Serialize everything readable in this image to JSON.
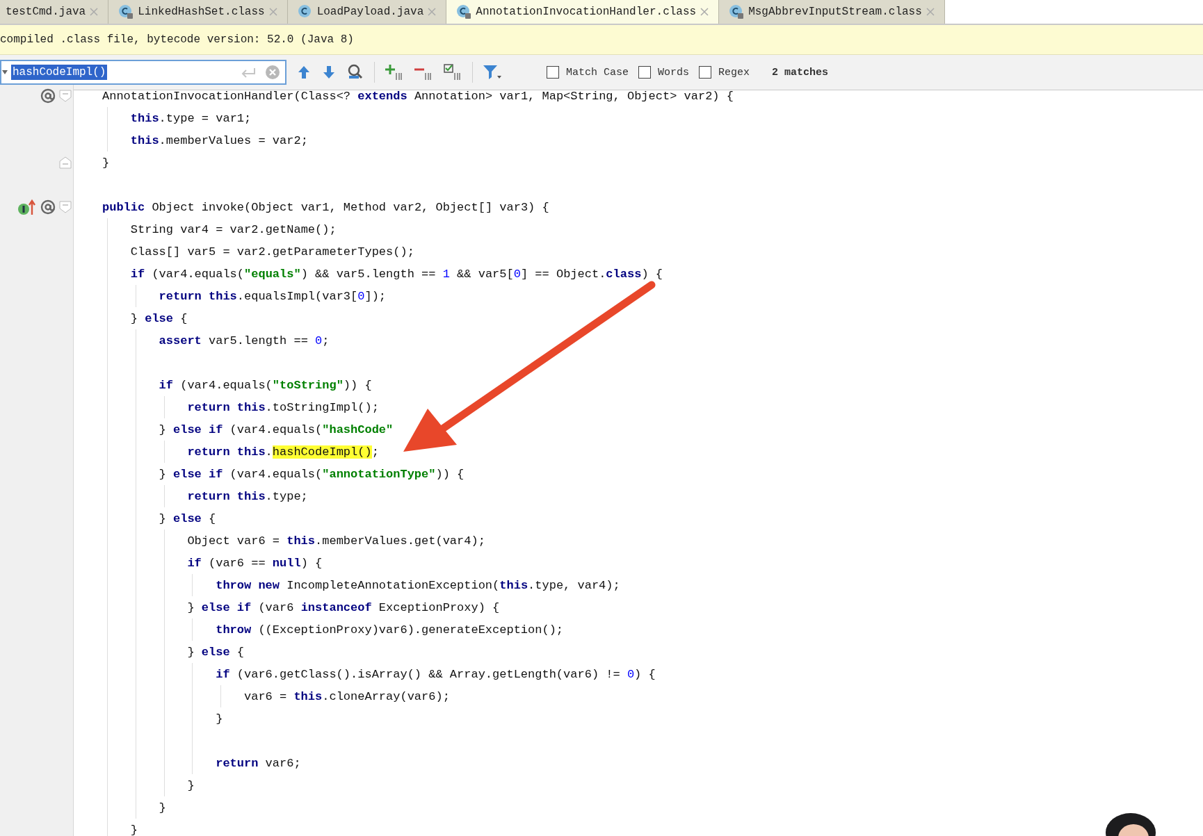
{
  "tabs": [
    {
      "label": "testCmd.java",
      "kind": "plain",
      "selected": false
    },
    {
      "label": "LinkedHashSet.class",
      "kind": "class-locked",
      "selected": false
    },
    {
      "label": "LoadPayload.java",
      "kind": "class",
      "selected": false
    },
    {
      "label": "AnnotationInvocationHandler.class",
      "kind": "class-locked",
      "selected": true
    },
    {
      "label": "MsgAbbrevInputStream.class",
      "kind": "class-locked",
      "selected": false
    }
  ],
  "info_bar": {
    "text": "compiled .class file, bytecode version: 52.0 (Java 8)"
  },
  "search_bar": {
    "value": "hashCodeImpl()",
    "value_selected": true,
    "options": [
      {
        "label": "Match Case",
        "checked": false
      },
      {
        "label": "Words",
        "checked": false
      },
      {
        "label": "Regex",
        "checked": false
      }
    ],
    "result": "2 matches"
  },
  "code": [
    {
      "kind": "code",
      "annotation_mark": true,
      "fold_open": true,
      "segments": [
        {
          "kind": "text",
          "text": "AnnotationInvocationHandler(Class<? "
        },
        {
          "kind": "kw",
          "text": "extends"
        },
        {
          "kind": "text",
          "text": " Annotation> var1, Map<String, Object> var2) {"
        }
      ],
      "children": [
        {
          "kind": "code",
          "segments": [
            {
              "kind": "kw",
              "text": "this"
            },
            {
              "kind": "text",
              "text": ".type = var1;"
            }
          ]
        },
        {
          "kind": "code",
          "segments": [
            {
              "kind": "kw",
              "text": "this"
            },
            {
              "kind": "text",
              "text": ".memberValues = var2;"
            }
          ]
        }
      ]
    },
    {
      "kind": "code",
      "fold_close": true,
      "segments": [
        {
          "kind": "text",
          "text": "}"
        }
      ]
    },
    {
      "kind": "blank"
    },
    {
      "kind": "code",
      "implements_mark": true,
      "annotation_mark": true,
      "fold_open": true,
      "segments": [
        {
          "kind": "kw",
          "text": "public"
        },
        {
          "kind": "text",
          "text": " Object invoke(Object var1, Method var2, Object[] var3) {"
        }
      ],
      "children": [
        {
          "kind": "code",
          "segments": [
            {
              "kind": "text",
              "text": "String var4 = var2.getName();"
            }
          ]
        },
        {
          "kind": "code",
          "segments": [
            {
              "kind": "text",
              "text": "Class[] var5 = var2.getParameterTypes();"
            }
          ]
        },
        {
          "kind": "code",
          "segments": [
            {
              "kind": "kw",
              "text": "if"
            },
            {
              "kind": "text",
              "text": " (var4.equals("
            },
            {
              "kind": "str",
              "text": "\"equals\""
            },
            {
              "kind": "text",
              "text": ") && var5.length == "
            },
            {
              "kind": "num",
              "text": "1"
            },
            {
              "kind": "text",
              "text": " && var5["
            },
            {
              "kind": "num",
              "text": "0"
            },
            {
              "kind": "text",
              "text": "] == Object."
            },
            {
              "kind": "kw",
              "text": "class"
            },
            {
              "kind": "text",
              "text": ") {"
            }
          ],
          "children": [
            {
              "kind": "code",
              "segments": [
                {
                  "kind": "kw",
                  "text": "return this"
                },
                {
                  "kind": "text",
                  "text": ".equalsImpl(var3["
                },
                {
                  "kind": "num",
                  "text": "0"
                },
                {
                  "kind": "text",
                  "text": "]);"
                }
              ]
            }
          ]
        },
        {
          "kind": "code",
          "segments": [
            {
              "kind": "text",
              "text": "} "
            },
            {
              "kind": "kw",
              "text": "else"
            },
            {
              "kind": "text",
              "text": " {"
            }
          ],
          "children": [
            {
              "kind": "code",
              "segments": [
                {
                  "kind": "kw",
                  "text": "assert"
                },
                {
                  "kind": "text",
                  "text": " var5.length == "
                },
                {
                  "kind": "num",
                  "text": "0"
                },
                {
                  "kind": "text",
                  "text": ";"
                }
              ]
            },
            {
              "kind": "blank"
            },
            {
              "kind": "code",
              "segments": [
                {
                  "kind": "kw",
                  "text": "if"
                },
                {
                  "kind": "text",
                  "text": " (var4.equals("
                },
                {
                  "kind": "str",
                  "text": "\"toString\""
                },
                {
                  "kind": "text",
                  "text": ")) {"
                }
              ],
              "children": [
                {
                  "kind": "code",
                  "segments": [
                    {
                      "kind": "kw",
                      "text": "return this"
                    },
                    {
                      "kind": "text",
                      "text": ".toStringImpl();"
                    }
                  ]
                }
              ]
            },
            {
              "kind": "code",
              "segments": [
                {
                  "kind": "text",
                  "text": "} "
                },
                {
                  "kind": "kw",
                  "text": "else if"
                },
                {
                  "kind": "text",
                  "text": " (var4.equals("
                },
                {
                  "kind": "str",
                  "text": "\"hashCode\""
                }
              ],
              "children": [
                {
                  "kind": "code",
                  "segments": [
                    {
                      "kind": "kw",
                      "text": "return this"
                    },
                    {
                      "kind": "text",
                      "text": "."
                    },
                    {
                      "kind": "match",
                      "text": "hashCodeImpl()"
                    },
                    {
                      "kind": "text",
                      "text": ";"
                    }
                  ]
                }
              ]
            },
            {
              "kind": "code",
              "segments": [
                {
                  "kind": "text",
                  "text": "} "
                },
                {
                  "kind": "kw",
                  "text": "else if"
                },
                {
                  "kind": "text",
                  "text": " (var4.equals("
                },
                {
                  "kind": "str",
                  "text": "\"annotationType\""
                },
                {
                  "kind": "text",
                  "text": ")) {"
                }
              ],
              "children": [
                {
                  "kind": "code",
                  "segments": [
                    {
                      "kind": "kw",
                      "text": "return this"
                    },
                    {
                      "kind": "text",
                      "text": ".type;"
                    }
                  ]
                }
              ]
            },
            {
              "kind": "code",
              "segments": [
                {
                  "kind": "text",
                  "text": "} "
                },
                {
                  "kind": "kw",
                  "text": "else"
                },
                {
                  "kind": "text",
                  "text": " {"
                }
              ],
              "children": [
                {
                  "kind": "code",
                  "segments": [
                    {
                      "kind": "text",
                      "text": "Object var6 = "
                    },
                    {
                      "kind": "kw",
                      "text": "this"
                    },
                    {
                      "kind": "text",
                      "text": ".memberValues.get(var4);"
                    }
                  ]
                },
                {
                  "kind": "code",
                  "segments": [
                    {
                      "kind": "kw",
                      "text": "if"
                    },
                    {
                      "kind": "text",
                      "text": " (var6 == "
                    },
                    {
                      "kind": "kw",
                      "text": "null"
                    },
                    {
                      "kind": "text",
                      "text": ") {"
                    }
                  ],
                  "children": [
                    {
                      "kind": "code",
                      "segments": [
                        {
                          "kind": "kw",
                          "text": "throw new"
                        },
                        {
                          "kind": "text",
                          "text": " IncompleteAnnotationException("
                        },
                        {
                          "kind": "kw",
                          "text": "this"
                        },
                        {
                          "kind": "text",
                          "text": ".type, var4);"
                        }
                      ]
                    }
                  ]
                },
                {
                  "kind": "code",
                  "segments": [
                    {
                      "kind": "text",
                      "text": "} "
                    },
                    {
                      "kind": "kw",
                      "text": "else if"
                    },
                    {
                      "kind": "text",
                      "text": " (var6 "
                    },
                    {
                      "kind": "kw",
                      "text": "instanceof"
                    },
                    {
                      "kind": "text",
                      "text": " ExceptionProxy) {"
                    }
                  ],
                  "children": [
                    {
                      "kind": "code",
                      "segments": [
                        {
                          "kind": "kw",
                          "text": "throw"
                        },
                        {
                          "kind": "text",
                          "text": " ((ExceptionProxy)var6).generateException();"
                        }
                      ]
                    }
                  ]
                },
                {
                  "kind": "code",
                  "segments": [
                    {
                      "kind": "text",
                      "text": "} "
                    },
                    {
                      "kind": "kw",
                      "text": "else"
                    },
                    {
                      "kind": "text",
                      "text": " {"
                    }
                  ],
                  "children": [
                    {
                      "kind": "code",
                      "segments": [
                        {
                          "kind": "kw",
                          "text": "if"
                        },
                        {
                          "kind": "text",
                          "text": " (var6.getClass().isArray() && Array.getLength(var6) != "
                        },
                        {
                          "kind": "num",
                          "text": "0"
                        },
                        {
                          "kind": "text",
                          "text": ") {"
                        }
                      ],
                      "children": [
                        {
                          "kind": "code",
                          "segments": [
                            {
                              "kind": "text",
                              "text": "var6 = "
                            },
                            {
                              "kind": "kw",
                              "text": "this"
                            },
                            {
                              "kind": "text",
                              "text": ".cloneArray(var6);"
                            }
                          ]
                        }
                      ]
                    },
                    {
                      "kind": "code",
                      "segments": [
                        {
                          "kind": "text",
                          "text": "}"
                        }
                      ]
                    },
                    {
                      "kind": "blank"
                    },
                    {
                      "kind": "code",
                      "segments": [
                        {
                          "kind": "kw",
                          "text": "return"
                        },
                        {
                          "kind": "text",
                          "text": " var6;"
                        }
                      ]
                    }
                  ]
                },
                {
                  "kind": "code",
                  "segments": [
                    {
                      "kind": "text",
                      "text": "}"
                    }
                  ]
                }
              ]
            },
            {
              "kind": "code",
              "segments": [
                {
                  "kind": "text",
                  "text": "}"
                }
              ]
            }
          ]
        },
        {
          "kind": "code",
          "segments": [
            {
              "kind": "text",
              "text": "}"
            }
          ]
        }
      ]
    }
  ]
}
